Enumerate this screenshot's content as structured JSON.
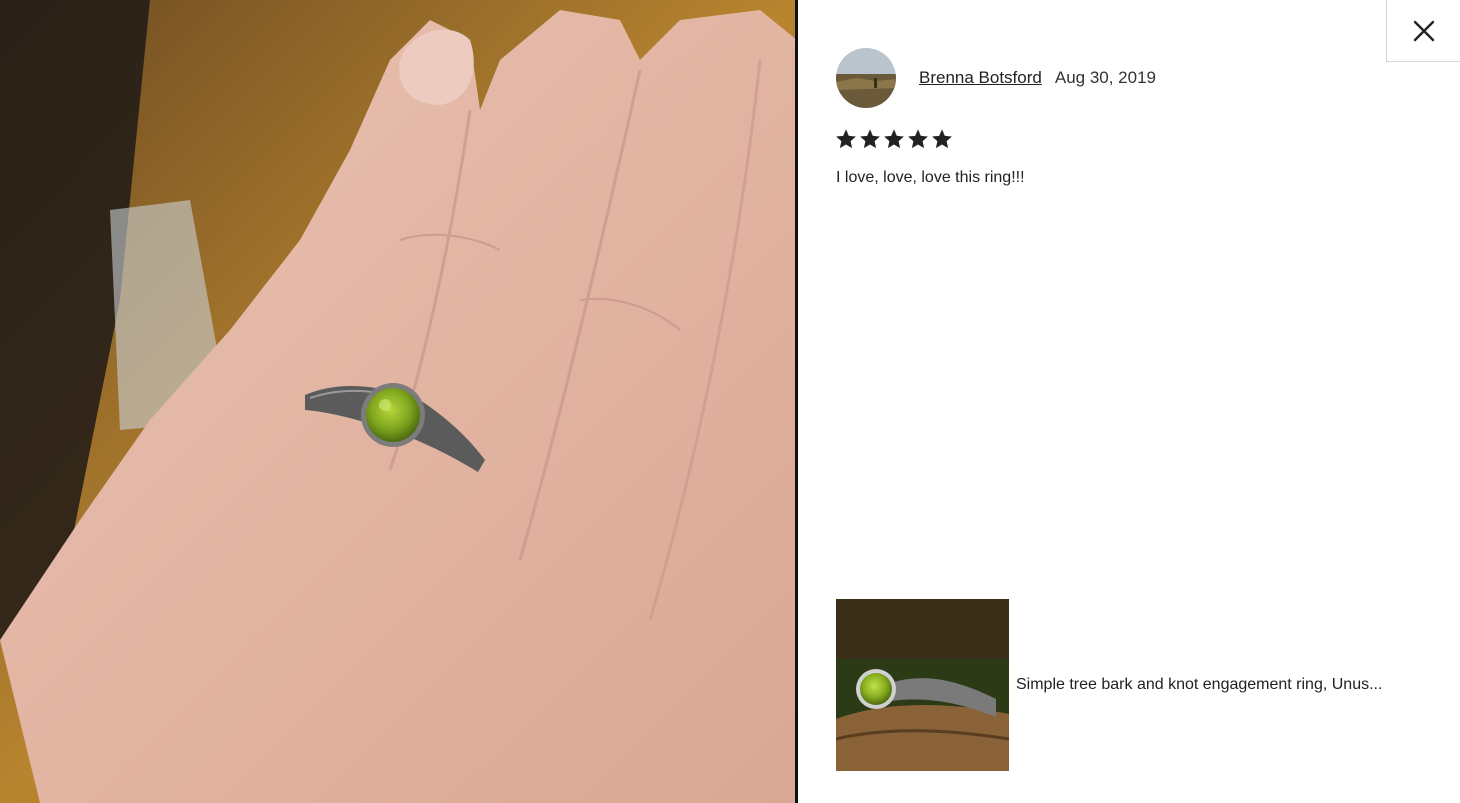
{
  "review": {
    "reviewer_name": "Brenna Botsford",
    "date": "Aug 30, 2019",
    "rating": 5,
    "max_rating": 5,
    "text": "I love, love, love this ring!!!"
  },
  "listing": {
    "title": "Simple tree bark and knot engagement ring, Unus..."
  },
  "icons": {
    "close": "close-icon",
    "star": "star-icon"
  },
  "colors": {
    "star": "#222222",
    "gem": "#7fa61e",
    "divider": "#111111"
  }
}
